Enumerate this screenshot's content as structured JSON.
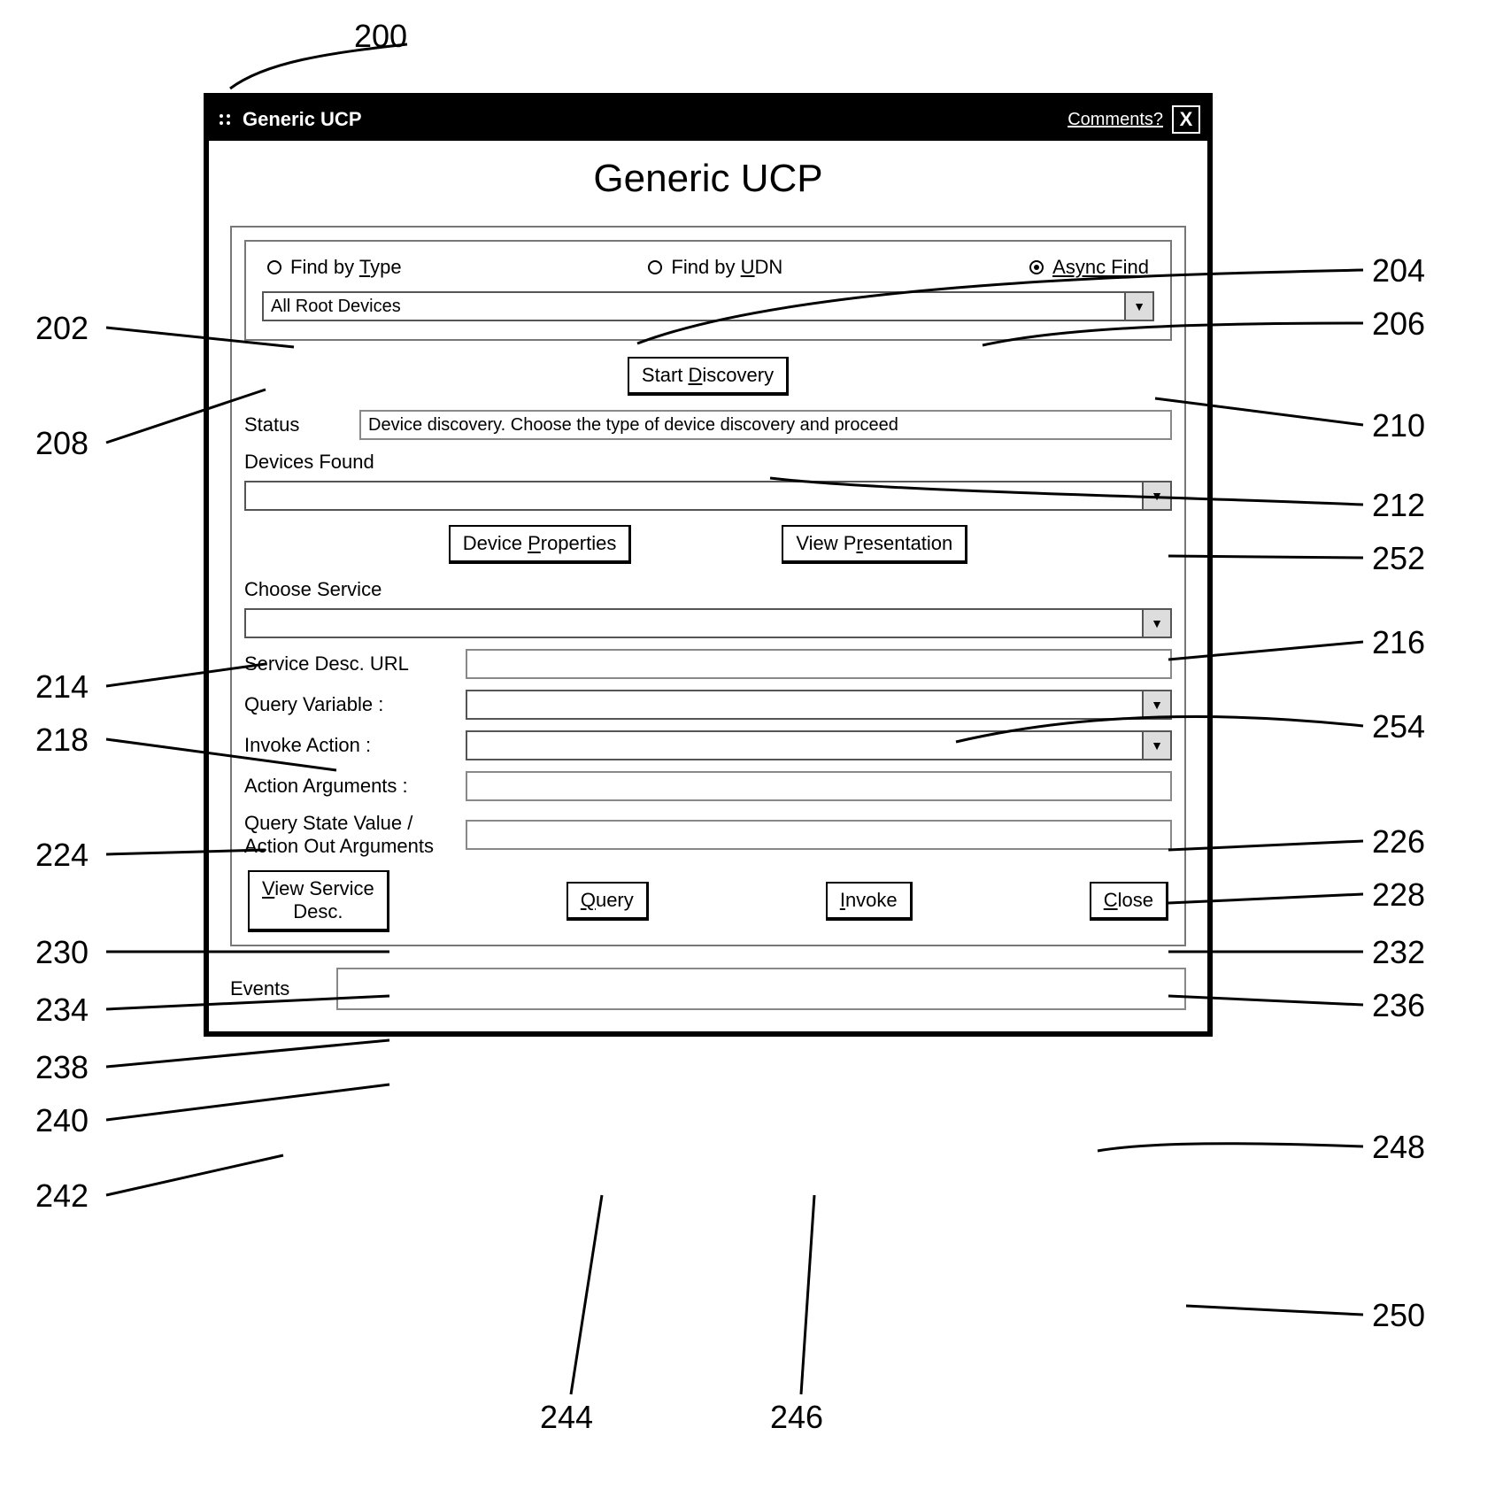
{
  "figure_callouts": {
    "c200": "200",
    "c202": "202",
    "c204": "204",
    "c206": "206",
    "c208": "208",
    "c210": "210",
    "c212": "212",
    "c214": "214",
    "c216": "216",
    "c218": "218",
    "c224": "224",
    "c226": "226",
    "c228": "228",
    "c230": "230",
    "c232": "232",
    "c234": "234",
    "c236": "236",
    "c238": "238",
    "c240": "240",
    "c242": "242",
    "c244": "244",
    "c246": "246",
    "c248": "248",
    "c250": "250",
    "c252": "252",
    "c254": "254"
  },
  "titlebar": {
    "title": "Generic UCP",
    "comments": "Comments?",
    "close": "X"
  },
  "heading": "Generic UCP",
  "find_panel": {
    "radio_type_prefix": "Find by ",
    "radio_type_key": "T",
    "radio_type_suffix": "ype",
    "radio_udn_prefix": "Find by ",
    "radio_udn_key": "U",
    "radio_udn_suffix": "DN",
    "radio_async_key": "A",
    "radio_async_suffix": "sync Find",
    "devices_combo": "All Root Devices"
  },
  "buttons": {
    "start_discovery_pre": "Start ",
    "start_discovery_key": "D",
    "start_discovery_post": "iscovery",
    "device_properties_pre": "Device ",
    "device_properties_key": "P",
    "device_properties_post": "roperties",
    "view_presentation_pre": "View P",
    "view_presentation_key": "r",
    "view_presentation_post": "esentation",
    "view_service_key": "V",
    "view_service_line1_post": "iew Service",
    "view_service_line2": "Desc.",
    "query_key": "Q",
    "query_post": "uery",
    "invoke_key": "I",
    "invoke_post": "nvoke",
    "close_key": "C",
    "close_post": "lose"
  },
  "labels": {
    "status": "Status",
    "status_value": "Device discovery. Choose the type of device discovery and proceed",
    "devices_found": "Devices Found",
    "choose_service": "Choose Service",
    "service_desc_url": "Service Desc. URL",
    "query_variable": "Query Variable :",
    "invoke_action": "Invoke Action :",
    "action_arguments": "Action Arguments :",
    "query_state_l1": "Query State Value /",
    "query_state_l2": "Action Out Arguments",
    "events": "Events"
  }
}
